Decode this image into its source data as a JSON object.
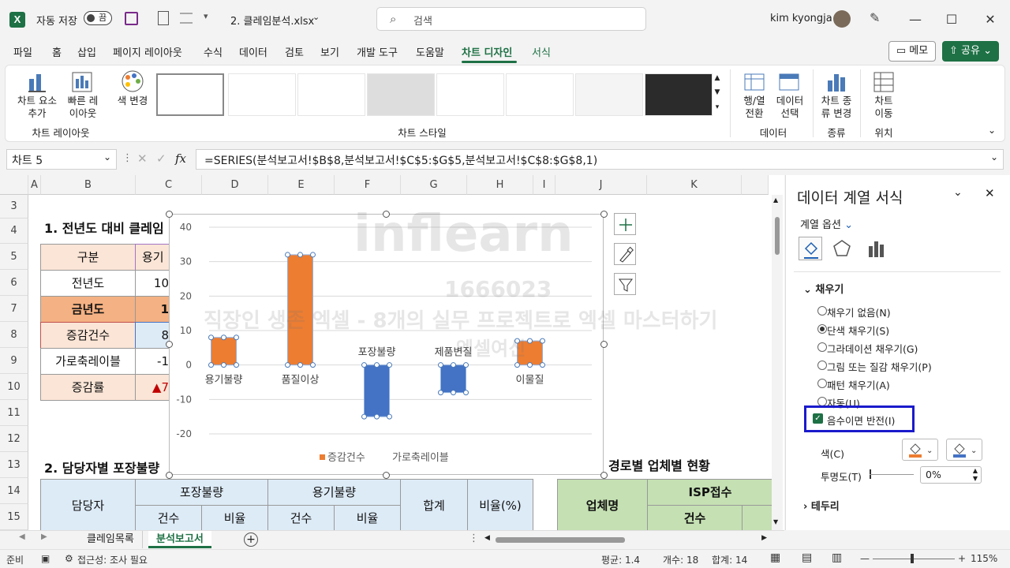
{
  "titlebar": {
    "autosave_label": "자동 저장",
    "autosave_state": "끔",
    "filename": "2. 클레임분석.xlsx",
    "search_placeholder": "검색",
    "user": "kim kyongja"
  },
  "menu": {
    "tabs": [
      "파일",
      "홈",
      "삽입",
      "페이지 레이아웃",
      "수식",
      "데이터",
      "검토",
      "보기",
      "개발 도구",
      "도움말",
      "차트 디자인",
      "서식"
    ],
    "active": "차트 디자인",
    "memo": "메모",
    "share": "공유"
  },
  "ribbon": {
    "add_element": "차트 요소\n추가",
    "quick_layout": "빠른 레\n이아웃",
    "change_color": "색 변경",
    "group_layout": "차트 레이아웃",
    "group_styles": "차트 스타일",
    "switch_rowcol": "행/열\n전환",
    "select_data": "데이터\n선택",
    "group_data": "데이터",
    "change_type": "차트 종\n류 변경",
    "group_type": "종류",
    "move_chart": "차트\n이동",
    "group_location": "위치"
  },
  "formula": {
    "name_box": "차트 5",
    "fx": "fx",
    "formula": "=SERIES(분석보고서!$B$8,분석보고서!$C$5:$G$5,분석보고서!$C$8:$G$8,1)"
  },
  "sheet": {
    "columns": [
      "A",
      "B",
      "C",
      "D",
      "E",
      "F",
      "G",
      "H",
      "I",
      "J",
      "K"
    ],
    "rows": [
      "3",
      "4",
      "5",
      "6",
      "7",
      "8",
      "9",
      "10",
      "11",
      "12",
      "13",
      "14",
      "15"
    ],
    "section1": "1. 전년도 대비 클레임",
    "section2": "2. 담당자별 포장불량",
    "section3": "경로별 업체별 현황",
    "table1_labels": [
      "구분",
      "전년도",
      "금년도",
      "증감건수",
      "가로축레이블",
      "증감률"
    ],
    "table1_values": [
      "용기",
      "10",
      "1",
      "8",
      "-1",
      "7"
    ],
    "table2_header": [
      "담당자",
      "포장불량",
      "용기불량",
      "합계",
      "비율(%)"
    ],
    "table2_sub": [
      "건수",
      "비율",
      "건수",
      "비율"
    ],
    "table3_header": [
      "업체명",
      "ISP접수",
      "건수"
    ]
  },
  "chart_data": {
    "type": "bar",
    "categories": [
      "용기불량",
      "품질이상",
      "포장불량",
      "제품변질",
      "이물질"
    ],
    "series": [
      {
        "name": "증감건수",
        "values": [
          8,
          32,
          -15,
          -8,
          7
        ],
        "color": "#ed7d31",
        "invert_color": "#4472c4"
      }
    ],
    "legend_entries": [
      "증감건수",
      "가로축레이블"
    ],
    "ylim": [
      -20,
      40
    ],
    "yticks": [
      "40",
      "30",
      "20",
      "10",
      "0",
      "-10",
      "-20"
    ],
    "grid": true,
    "legend_position": "bottom"
  },
  "pane": {
    "title": "데이터 계열 서식",
    "series_options": "계열 옵션",
    "fill_section": "채우기",
    "fill_options": [
      "채우기 없음(N)",
      "단색 채우기(S)",
      "그라데이션 채우기(G)",
      "그림 또는 질감 채우기(P)",
      "패턴 채우기(A)",
      "자동(U)"
    ],
    "selected_fill": "단색 채우기(S)",
    "invert_label": "음수이면 반전(I)",
    "color_label": "색(C)",
    "transparency_label": "투명도(T)",
    "transparency_value": "0%",
    "border_section": "테두리"
  },
  "tabs": {
    "sheets": [
      "클레임목록",
      "분석보고서"
    ],
    "active": "분석보고서"
  },
  "status": {
    "ready": "준비",
    "accessibility": "접근성: 조사 필요",
    "average": "평균: 1.4",
    "count": "개수: 18",
    "sum": "합계: 14",
    "zoom": "115%"
  },
  "watermark": [
    "inflearn",
    "1666023",
    "직장인 생존 엑셀 - 8개의 실무 프로젝트로 엑셀 마스터하기",
    "엑셀여신"
  ]
}
